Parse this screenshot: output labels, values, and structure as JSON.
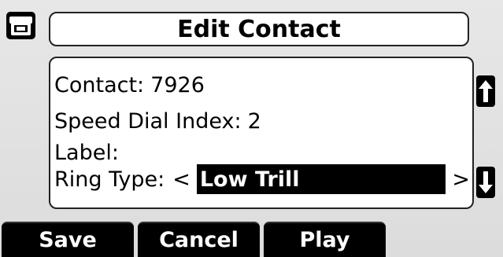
{
  "header": {
    "title": "Edit Contact",
    "line_icon": "phone-handset-icon"
  },
  "fields": {
    "contact_label": "Contact:",
    "contact_value": "7926",
    "speed_dial_label": "Speed Dial Index:",
    "speed_dial_value": "2",
    "label_label": "Label:",
    "label_value": "",
    "ring_type_label": "Ring Type:",
    "ring_type_prev": "<",
    "ring_type_value": "Low Trill",
    "ring_type_next": ">"
  },
  "scroll": {
    "up_icon": "arrow-up-icon",
    "down_icon": "arrow-down-icon"
  },
  "softkeys": {
    "save": "Save",
    "cancel": "Cancel",
    "play": "Play"
  }
}
